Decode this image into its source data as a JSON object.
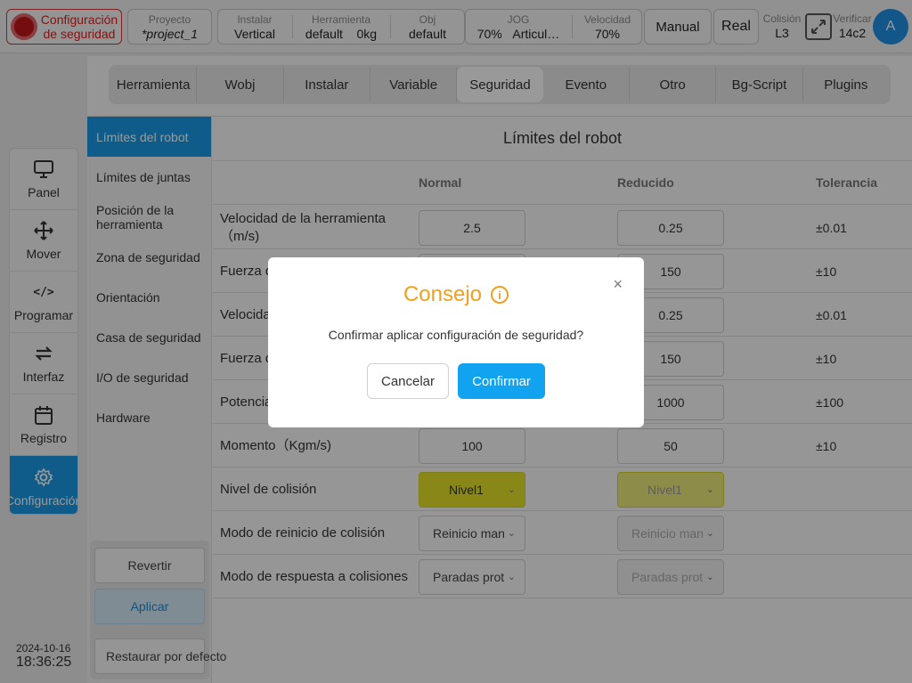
{
  "topbar": {
    "safety": "Configuración de seguridad",
    "project_label": "Proyecto",
    "project_value": "*project_1",
    "install_label": "Instalar",
    "install_value": "Vertical",
    "tool_label": "Herramienta",
    "tool_value": "default",
    "tool_weight": "0kg",
    "obj_label": "Obj",
    "obj_value": "default",
    "jog_label": "JOG",
    "jog_value": "70%",
    "jog_mode": "Articul…",
    "speed_label": "Velocidad",
    "speed_value": "70%",
    "manual": "Manual",
    "real": "Real",
    "collision_label": "Colisión",
    "collision_value": "L3",
    "verify_label": "Verificar",
    "verify_value": "14c2",
    "avatar": "A"
  },
  "leftnav": [
    {
      "label": "Panel",
      "icon": "monitor-icon"
    },
    {
      "label": "Mover",
      "icon": "move-icon"
    },
    {
      "label": "Programar",
      "icon": "code-icon"
    },
    {
      "label": "Interfaz",
      "icon": "interface-icon"
    },
    {
      "label": "Registro",
      "icon": "calendar-icon"
    },
    {
      "label": "Configuración",
      "icon": "gear-icon",
      "active": true
    }
  ],
  "datetime": {
    "date": "2024-10-16",
    "time": "18:36:25"
  },
  "tabs": [
    "Herramienta",
    "Wobj",
    "Instalar",
    "Variable",
    "Seguridad",
    "Evento",
    "Otro",
    "Bg-Script",
    "Plugins"
  ],
  "active_tab": "Seguridad",
  "sidemenu": [
    "Límites del robot",
    "Límites de juntas",
    "Posición de la herramienta",
    "Zona de seguridad",
    "Orientación",
    "Casa de seguridad",
    "I/O de seguridad",
    "Hardware"
  ],
  "actions": {
    "revert": "Revertir",
    "apply": "Aplicar",
    "restore": "Restaurar por defecto"
  },
  "content": {
    "title": "Límites del robot",
    "col_normal": "Normal",
    "col_reduced": "Reducido",
    "col_tolerance": "Tolerancia",
    "rows": [
      {
        "label": "Velocidad de la herramienta（m/s)",
        "normal": "2.5",
        "reduced": "0.25",
        "tolerance": "±0.01"
      },
      {
        "label": "Fuerza de",
        "normal": "",
        "reduced": "150",
        "tolerance": "±10"
      },
      {
        "label": "Velocida",
        "normal": "",
        "reduced": "0.25",
        "tolerance": "±0.01"
      },
      {
        "label": "Fuerza d",
        "normal": "",
        "reduced": "150",
        "tolerance": "±10"
      },
      {
        "label": "Potencia",
        "normal": "",
        "reduced": "1000",
        "tolerance": "±100"
      },
      {
        "label": "Momento（Kgm/s)",
        "normal": "100",
        "reduced": "50",
        "tolerance": "±10"
      }
    ],
    "collision_level": {
      "label": "Nivel de colisión",
      "normal": "Nivel1",
      "reduced": "Nivel1"
    },
    "collision_reset": {
      "label": "Modo de reinicio de colisión",
      "normal": "Reinicio manual",
      "reduced": "Reinicio manual"
    },
    "collision_response": {
      "label": "Modo de respuesta a colisiones",
      "normal": "Paradas protectoras",
      "reduced": "Paradas protectoras"
    }
  },
  "modal": {
    "title": "Consejo",
    "info": "i",
    "close": "×",
    "message": "Confirmar aplicar configuración de seguridad?",
    "cancel": "Cancelar",
    "confirm": "Confirmar"
  },
  "colors": {
    "accent": "#1a9ae6",
    "warning": "#f0a020",
    "danger": "#d22222",
    "collision_yellow": "#e6e22a"
  }
}
